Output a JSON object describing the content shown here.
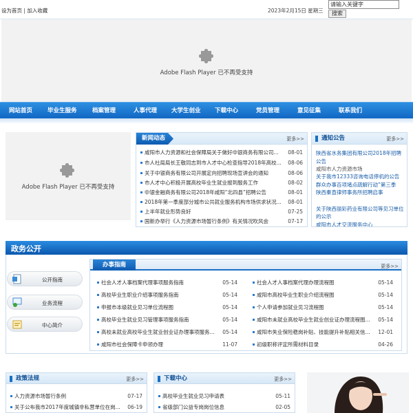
{
  "topbar": {
    "set_home": "设为首页",
    "separator": "|",
    "add_fav": "加入收藏",
    "date": "2023年2月15日 星期三",
    "search_placeholder": "请输入关键字",
    "search_button": "搜索"
  },
  "flash_message": "Adobe Flash Player 已不再受支持",
  "nav": [
    "网站首页",
    "毕业生服务",
    "档案管理",
    "人事代理",
    "大学生创业",
    "下载中心",
    "党员管理",
    "意见征集",
    "联系我们"
  ],
  "news": {
    "title": "新闻动态",
    "more": "更多>>",
    "items": [
      {
        "title": "咸阳市人力资源和社会保障局关于做好中银商务有限公司...",
        "date": "08-01"
      },
      {
        "title": "市人社局局长王敬同志到市人才中心检查指导2018年高校...",
        "date": "08-06"
      },
      {
        "title": "关于中银商务有限公司开展定向招聘现场宣讲会的通知",
        "date": "08-06"
      },
      {
        "title": "市人才中心积极开展高校毕业生就业报到服务工作",
        "date": "08-02"
      },
      {
        "title": "中银金融商务有限公司2018年咸阳“北四县”招聘公告",
        "date": "08-01"
      },
      {
        "title": "2018年第一季度部分城市公共就业服务机构市场供求状况...",
        "date": "08-01"
      },
      {
        "title": "上半年就业形势良好",
        "date": "07-25"
      },
      {
        "title": "国新办举行《人力资源市场暂行条例》有关情况吹风会",
        "date": "07-17"
      }
    ]
  },
  "notice": {
    "title": "通知公告",
    "more": "更多>>",
    "items": [
      "陕西省水务集团有限公司2018年招聘公告",
      "咸阳市人力资源市场",
      "关于我市12333咨询电话停机的公告",
      "群众办事百项堵点疏解行动”第三季",
      "陕西秦直律师事务所招聘启事",
      "关于陕西丽彩药业有限公司等见习单位的公示",
      "咸阳市人才交流服务中心"
    ]
  },
  "gov": {
    "title": "政务公开",
    "side": [
      "公开指南",
      "业务流程",
      "中心简介"
    ],
    "guide_title": "办事指南",
    "more": "更多>>",
    "left": [
      {
        "title": "社会人才人事档案代理事项服务指南",
        "date": "05-14"
      },
      {
        "title": "高校毕业生职业介绍事项服务指南",
        "date": "05-14"
      },
      {
        "title": "申报市本级就业见习单位流程图",
        "date": "05-14"
      },
      {
        "title": "高校毕业生就业见习管理事项服务指南",
        "date": "05-14"
      },
      {
        "title": "高校未就业高校毕业生就业创业证办理事项服务...",
        "date": "05-14"
      },
      {
        "title": "咸阳市社会保障卡申领办理",
        "date": "11-07"
      }
    ],
    "right": [
      {
        "title": "社会人才人事档案代理办理流程图",
        "date": "05-14"
      },
      {
        "title": "咸阳市高校毕业生职业介绍流程图",
        "date": "05-14"
      },
      {
        "title": "个人申请参加就业见习流程图",
        "date": "05-14"
      },
      {
        "title": "咸阳市未就业高校毕业生就业创业证办理流程图...",
        "date": "05-14"
      },
      {
        "title": "咸阳市失业保险稳岗补贴、技能提升补贴相关信...",
        "date": "12-01"
      },
      {
        "title": "初级职称评定所需材料目录",
        "date": "04-26"
      }
    ]
  },
  "policy": {
    "title": "政策法规",
    "more": "更多>>",
    "items": [
      {
        "title": "人力资源市场暂行条例",
        "date": "07-17"
      },
      {
        "title": "关于公布我市2017年度城镇非私营单位在岗...",
        "date": "06-19"
      }
    ]
  },
  "download": {
    "title": "下载中心",
    "more": "更多>>",
    "items": [
      {
        "title": "高校毕业生就业见习申请表",
        "date": "05-11"
      },
      {
        "title": "省级部门公益专岗岗位信息",
        "date": "02-05"
      }
    ]
  },
  "colors": {
    "primary": "#1167c4",
    "accent": "#2b7ad0",
    "border": "#c9dcec"
  }
}
